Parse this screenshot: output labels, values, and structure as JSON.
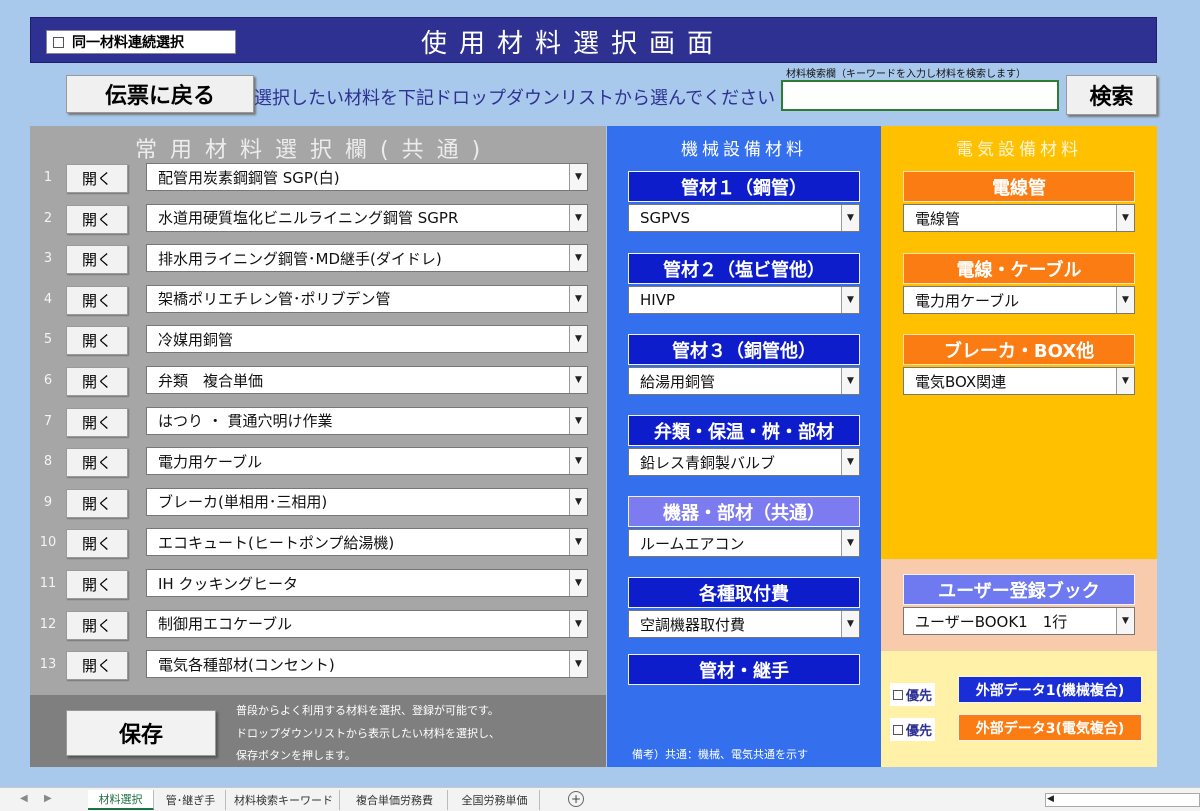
{
  "header": {
    "title": "使用材料選択画面",
    "continuous_select_label": "同一材料連続選択"
  },
  "toolbar": {
    "back_label": "伝票に戻る",
    "instruction": "選択したい材料を下記ドロップダウンリストから選んでください",
    "search_caption": "材料検索欄（キーワードを入力し材料を検索します）",
    "search_value": "",
    "search_label": "検索"
  },
  "common": {
    "header": "常用材料選択欄(共通)",
    "open_label": "開く",
    "rows": [
      {
        "num": "1",
        "value": "配管用炭素鋼鋼管 SGP(白)"
      },
      {
        "num": "2",
        "value": "水道用硬質塩化ビニルライニング鋼管 SGPR"
      },
      {
        "num": "3",
        "value": "排水用ライニング鋼管･MD継手(ダイドレ)"
      },
      {
        "num": "4",
        "value": "架橋ポリエチレン管･ポリブデン管"
      },
      {
        "num": "5",
        "value": "冷媒用銅管"
      },
      {
        "num": "6",
        "value": "弁類　複合単価"
      },
      {
        "num": "7",
        "value": "はつり ・ 貫通穴明け作業"
      },
      {
        "num": "8",
        "value": "電力用ケーブル"
      },
      {
        "num": "9",
        "value": "ブレーカ(単相用･三相用)"
      },
      {
        "num": "10",
        "value": "エコキュート(ヒートポンプ給湯機)"
      },
      {
        "num": "11",
        "value": "IH クッキングヒータ"
      },
      {
        "num": "12",
        "value": "制御用エコケーブル"
      },
      {
        "num": "13",
        "value": "電気各種部材(コンセント)"
      }
    ],
    "save_label": "保存",
    "save_notes": [
      "普段からよく利用する材料を選択、登録が可能です。",
      "ドロップダウンリストから表示したい材料を選択し、",
      "保存ボタンを押します。"
    ]
  },
  "mechanical": {
    "header": "機械設備材料",
    "groups": [
      {
        "label": "管材１（鋼管）",
        "value": "SGPVS"
      },
      {
        "label": "管材２（塩ビ管他）",
        "value": "HIVP"
      },
      {
        "label": "管材３（銅管他）",
        "value": "給湯用銅管"
      },
      {
        "label": "弁類・保温・桝・部材",
        "value": "鉛レス青銅製バルブ"
      },
      {
        "label": "機器・部材（共通）",
        "value": "ルームエアコン"
      },
      {
        "label": "各種取付費",
        "value": "空調機器取付費"
      },
      {
        "label": "管材・継手"
      }
    ],
    "note": "備考）共通：機械、電気共通を示す"
  },
  "electrical": {
    "header": "電気設備材料",
    "groups": [
      {
        "label": "電線管",
        "value": "電線管"
      },
      {
        "label": "電線・ケーブル",
        "value": "電力用ケーブル"
      },
      {
        "label": "ブレーカ・BOX他",
        "value": "電気BOX関連"
      }
    ],
    "user_book_label": "ユーザー登録ブック",
    "user_book_value": "ユーザーBOOK1　1行",
    "priority_label": "優先",
    "external": [
      {
        "label": "外部データ1(機械複合)"
      },
      {
        "label": "外部データ3(電気複合)"
      }
    ]
  },
  "sheets": [
    "材料選択",
    "管･継ぎ手",
    "材料検索キーワード",
    "複合単価労務費",
    "全国労務単価"
  ],
  "colors": {
    "title_bar": "#2e3192",
    "mechanical_panel": "#3470ee",
    "electrical_panel": "#ffc000",
    "electrical_button": "#fb7c12",
    "mechanical_button": "#0d1dcc"
  }
}
